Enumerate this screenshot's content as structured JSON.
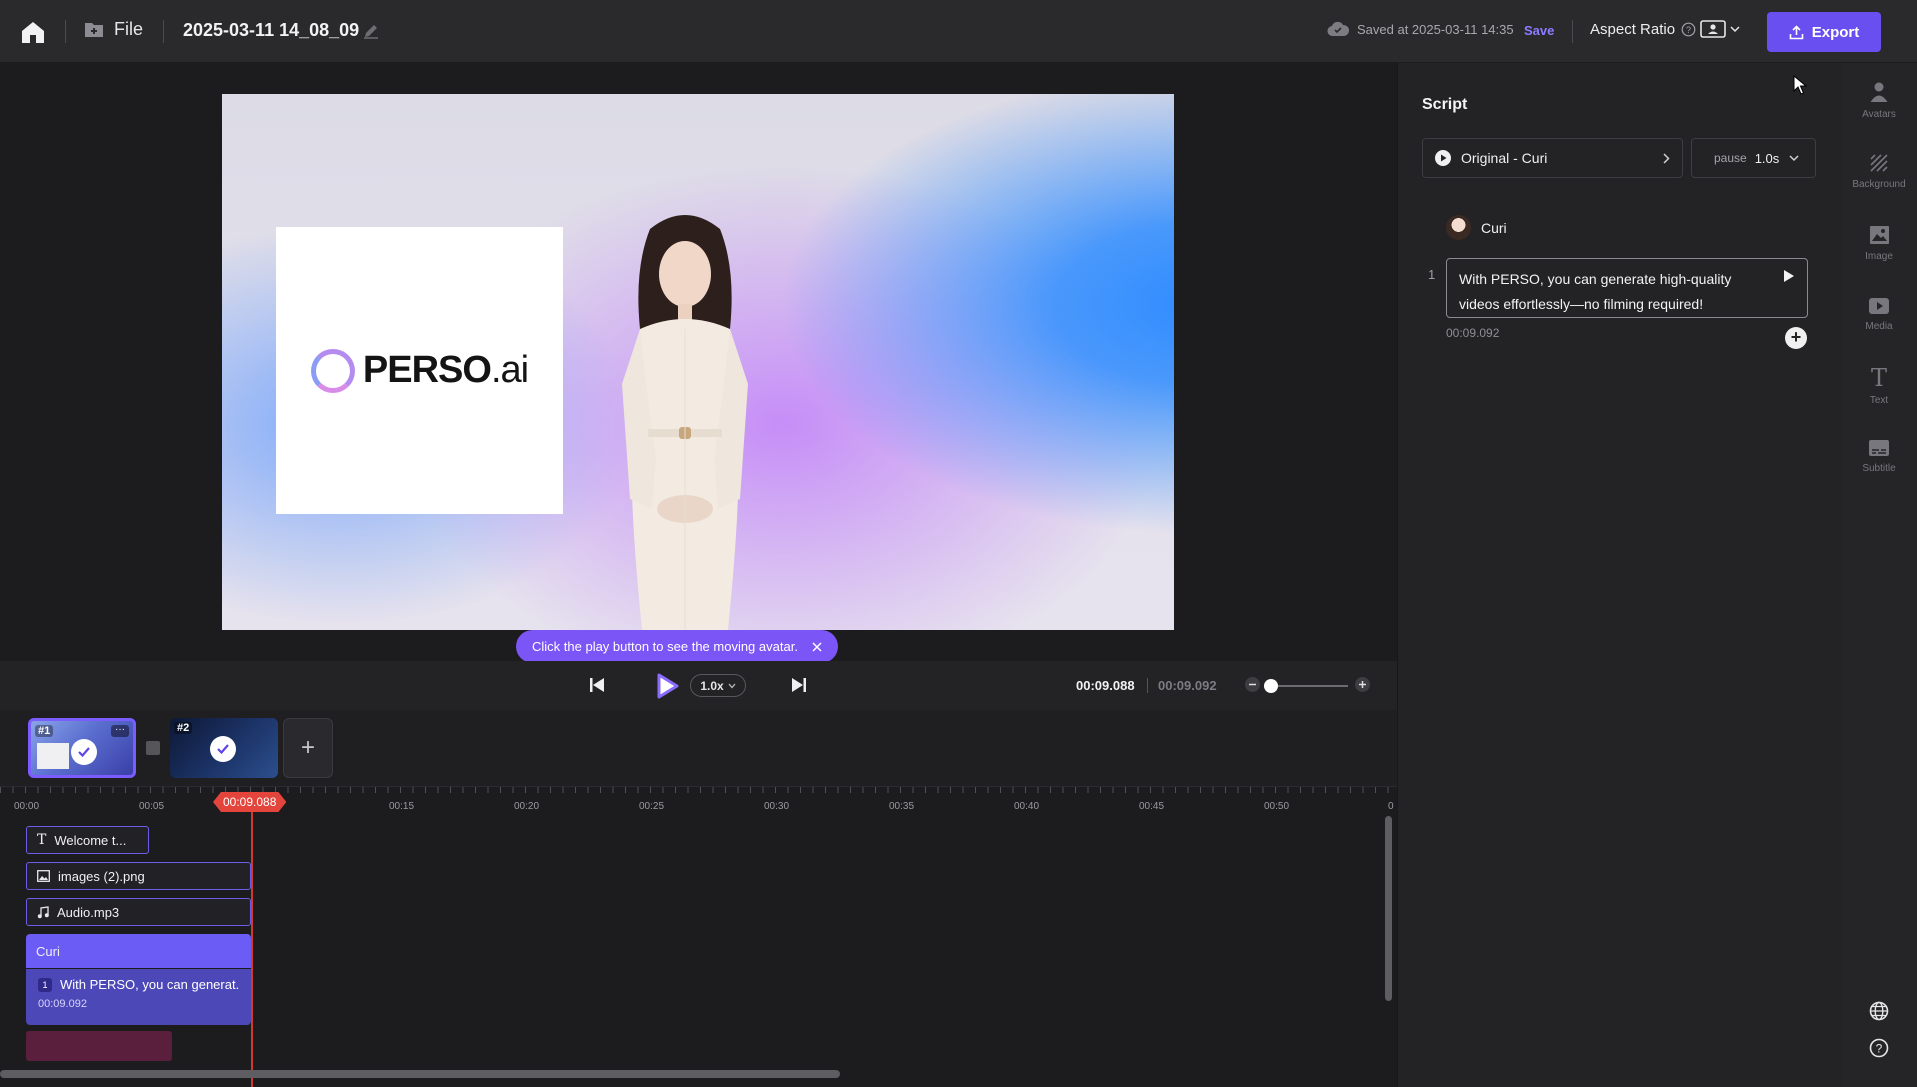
{
  "header": {
    "file_label": "File",
    "doc_title": "2025-03-11 14_08_09",
    "saved_text": "Saved at 2025-03-11 14:35",
    "save_label": "Save",
    "aspect_label": "Aspect Ratio",
    "export_label": "Export"
  },
  "canvas": {
    "logo_text": "PERSO",
    "logo_suffix": ".ai",
    "tooltip": "Click the play button to see the moving avatar."
  },
  "playback": {
    "speed": "1.0x",
    "current_time": "00:09.088",
    "total_time": "00:09.092"
  },
  "scenes": [
    {
      "label": "#1"
    },
    {
      "label": "#2"
    }
  ],
  "timeline": {
    "ruler_ticks": [
      "00:00",
      "00:05",
      "00:15",
      "00:20",
      "00:25",
      "00:30",
      "00:35",
      "00:40",
      "00:45",
      "00:50",
      "0"
    ],
    "playhead": "00:09.088",
    "tracks": {
      "text_clip": "Welcome t...",
      "image_clip": "images (2).png",
      "audio_clip": "Audio.mp3",
      "avatar_clip": "Curi",
      "script_num": "1",
      "script_clip": "With PERSO, you can generat...",
      "script_time": "00:09.092"
    }
  },
  "script_panel": {
    "title": "Script",
    "voice": "Original - Curi",
    "pause_label": "pause",
    "pause_value": "1.0s",
    "speaker": "Curi",
    "line_number": "1",
    "line_text": "With PERSO, you can generate high-quality videos effortlessly—no filming required!",
    "line_time": "00:09.092"
  },
  "right_toolbar": [
    {
      "label": "Avatars",
      "icon": "person-icon"
    },
    {
      "label": "Background",
      "icon": "background-icon"
    },
    {
      "label": "Image",
      "icon": "image-icon"
    },
    {
      "label": "Media",
      "icon": "media-icon"
    },
    {
      "label": "Text",
      "icon": "text-icon"
    },
    {
      "label": "Subtitle",
      "icon": "subtitle-icon"
    }
  ],
  "colors": {
    "accent": "#6a4ff0",
    "playhead": "#e3443b",
    "tooltip": "#7b55f5"
  }
}
